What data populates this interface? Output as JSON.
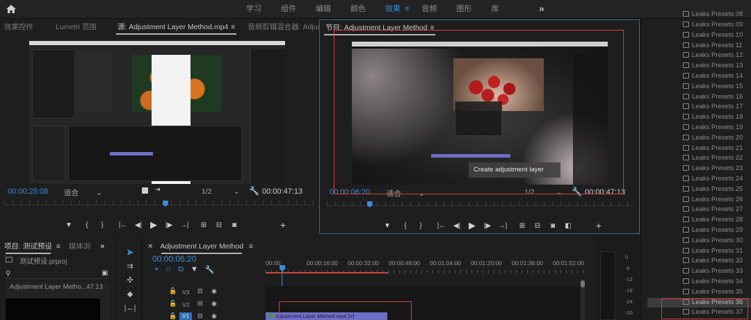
{
  "workspace": {
    "tabs": [
      {
        "label": "学习",
        "active": false
      },
      {
        "label": "组件",
        "active": false
      },
      {
        "label": "编辑",
        "active": false
      },
      {
        "label": "颜色",
        "active": false
      },
      {
        "label": "效果",
        "active": true
      },
      {
        "label": "音频",
        "active": false
      },
      {
        "label": "图形",
        "active": false
      },
      {
        "label": "库",
        "active": false
      }
    ],
    "more": "»"
  },
  "source_panel": {
    "tabs": [
      "效果控件",
      "Lumetri 范围",
      "源: Adjustment Layer Method.mp4",
      "音频剪辑混合器: Adjustme"
    ],
    "active_tab_index": 2,
    "timecode": "00:00:25:08",
    "fit": "适合",
    "resolution": "1/2",
    "duration": "00:00:47:13",
    "playhead_fraction": 0.52
  },
  "program_panel": {
    "tab": "节目: Adjustment Layer Method",
    "timecode": "00:00:06:20",
    "fit": "适合",
    "resolution": "1/2",
    "duration": "00:00:47:13",
    "overlay_text": "Create adjustment layer",
    "playhead_fraction": 0.14
  },
  "effects_panel": {
    "presets": [
      "Leaks Presets 09",
      "Leaks Presets 10",
      "Leaks Presets 11",
      "Leaks Presets 12",
      "Leaks Presets 13",
      "Leaks Presets 14",
      "Leaks Presets 15",
      "Leaks Presets 16",
      "Leaks Presets 17",
      "Leaks Presets 18",
      "Leaks Presets 19",
      "Leaks Presets 20",
      "Leaks Presets 21",
      "Leaks Presets 22",
      "Leaks Presets 23",
      "Leaks Presets 24",
      "Leaks Presets 25",
      "Leaks Presets 26",
      "Leaks Presets 27",
      "Leaks Presets 28",
      "Leaks Presets 29",
      "Leaks Presets 30",
      "Leaks Presets 31",
      "Leaks Presets 32",
      "Leaks Presets 33",
      "Leaks Presets 34",
      "Leaks Presets 35",
      "Leaks Presets 36",
      "Leaks Presets 37"
    ],
    "first_partial": "Leaks Presets 08",
    "selected": "Leaks Presets 36"
  },
  "project_panel": {
    "tabs": [
      "项目: 测试预设",
      "媒体浏"
    ],
    "file": "测试预设.prproj",
    "clip_name": "Adjustment Layer Metho...",
    "clip_duration": "47:13"
  },
  "timeline_panel": {
    "tab": "Adjustment Layer Method",
    "timecode": "00:00:06:20",
    "ruler": [
      "00:00",
      "00:00:16:00",
      "00:00:32:00",
      "00:00:48:00",
      "00:01:04:00",
      "00:01:20:00",
      "00:01:36:00",
      "00:01:52:00"
    ],
    "tracks": [
      "V3",
      "V2",
      "V1"
    ],
    "clip_label": "Adjustment Layer Method.mp4 [V]"
  },
  "meter": {
    "scale": [
      "0",
      "-6",
      "-12",
      "-18",
      "-24",
      "-30"
    ]
  },
  "colors": {
    "accent": "#3b8edb",
    "highlight_box": "#e03a3a",
    "clip": "#6f6fc7"
  }
}
